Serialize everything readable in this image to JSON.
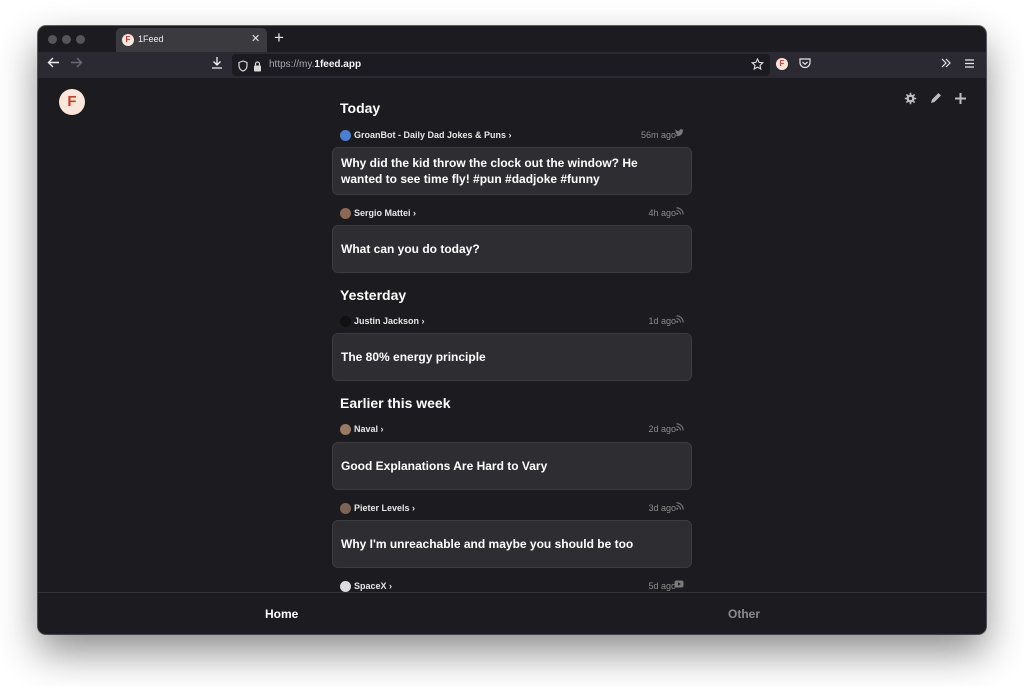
{
  "browser": {
    "tab": {
      "title": "1Feed",
      "favicon_letter": "F"
    },
    "new_tab_symbol": "+",
    "url": {
      "prefix": "https://my.",
      "domain": "1feed.app"
    },
    "icons": [
      "back-icon",
      "forward-icon",
      "download-icon",
      "shield-icon",
      "lock-icon",
      "star-icon",
      "pocket-icon",
      "overflow-icon",
      "menu-icon"
    ]
  },
  "app": {
    "logo_letter": "F",
    "actions": [
      "settings-icon",
      "edit-icon",
      "add-icon"
    ]
  },
  "feed": {
    "sections": [
      {
        "title": "Today",
        "items": [
          {
            "source": "GroanBot - Daily Dad Jokes & Puns",
            "time": "56m ago",
            "kind": "twitter-icon",
            "title": "Why did the kid throw the clock out the window? He wanted to see time fly! #pun #dadjoke #funny",
            "avatar_color": "#4a7fd6"
          },
          {
            "source": "Sergio Mattei",
            "time": "4h ago",
            "kind": "rss-icon",
            "title": "What can you do today?",
            "avatar_color": "#8a6a55"
          }
        ]
      },
      {
        "title": "Yesterday",
        "items": [
          {
            "source": "Justin Jackson",
            "time": "1d ago",
            "kind": "rss-icon",
            "title": "The 80% energy principle",
            "avatar_color": "#111111"
          }
        ]
      },
      {
        "title": "Earlier this week",
        "items": [
          {
            "source": "Naval",
            "time": "2d ago",
            "kind": "rss-icon",
            "title": "Good Explanations Are Hard to Vary",
            "avatar_color": "#9a7b62"
          },
          {
            "source": "Pieter Levels",
            "time": "3d ago",
            "kind": "rss-icon",
            "title": "Why I'm unreachable and maybe you should be too",
            "avatar_color": "#7d6454"
          },
          {
            "source": "SpaceX",
            "time": "5d ago",
            "kind": "youtube-icon",
            "title": "",
            "avatar_color": "#dcdcdc"
          }
        ]
      }
    ]
  },
  "bottom_nav": {
    "home": "Home",
    "other": "Other"
  },
  "colors": {
    "background": "#1c1b1f",
    "card": "#2e2d31",
    "accent": "#d0392b"
  }
}
